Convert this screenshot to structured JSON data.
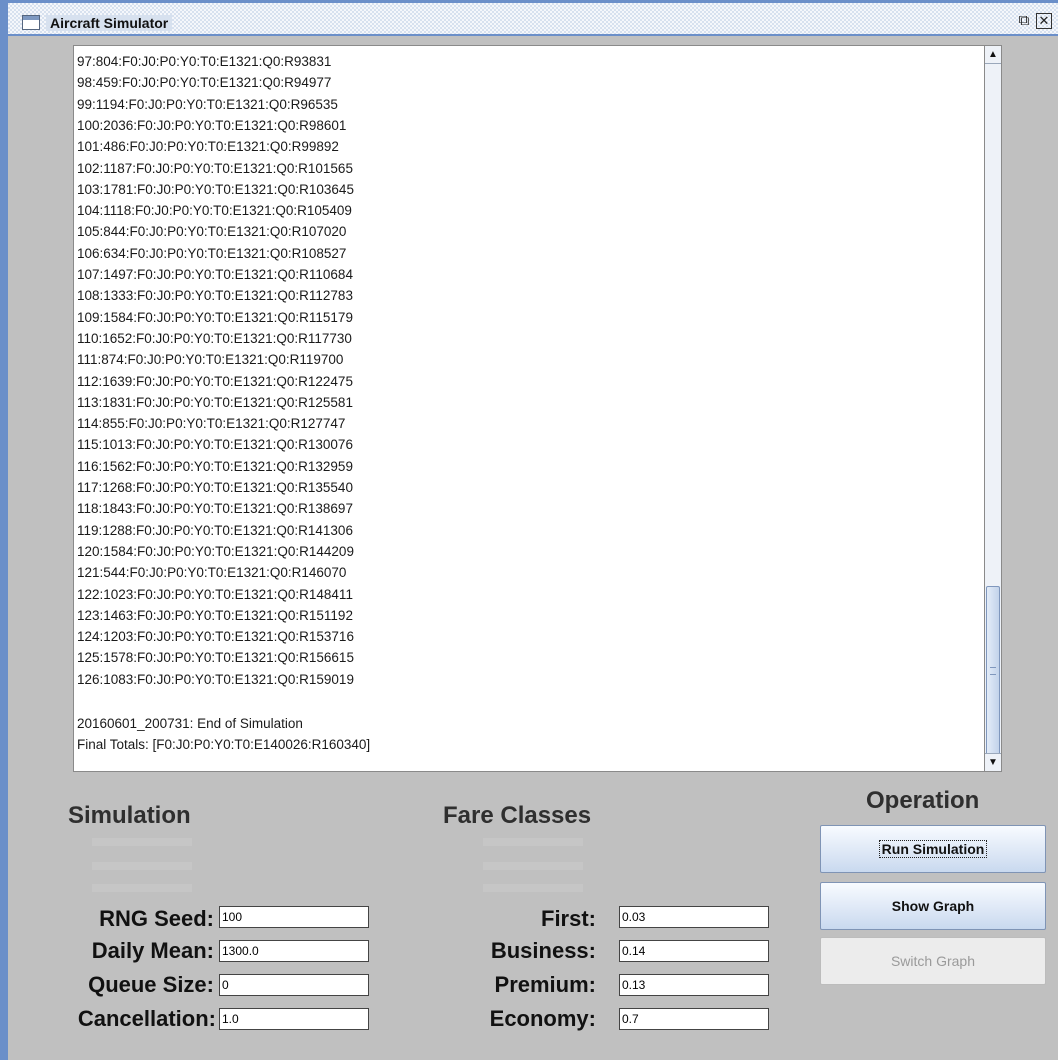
{
  "window": {
    "title": "Aircraft Simulator",
    "restore_glyph": "⧉",
    "close_glyph": "✕"
  },
  "log": {
    "lines": [
      "97:804:F0:J0:P0:Y0:T0:E1321:Q0:R93831",
      "98:459:F0:J0:P0:Y0:T0:E1321:Q0:R94977",
      "99:1194:F0:J0:P0:Y0:T0:E1321:Q0:R96535",
      "100:2036:F0:J0:P0:Y0:T0:E1321:Q0:R98601",
      "101:486:F0:J0:P0:Y0:T0:E1321:Q0:R99892",
      "102:1187:F0:J0:P0:Y0:T0:E1321:Q0:R101565",
      "103:1781:F0:J0:P0:Y0:T0:E1321:Q0:R103645",
      "104:1118:F0:J0:P0:Y0:T0:E1321:Q0:R105409",
      "105:844:F0:J0:P0:Y0:T0:E1321:Q0:R107020",
      "106:634:F0:J0:P0:Y0:T0:E1321:Q0:R108527",
      "107:1497:F0:J0:P0:Y0:T0:E1321:Q0:R110684",
      "108:1333:F0:J0:P0:Y0:T0:E1321:Q0:R112783",
      "109:1584:F0:J0:P0:Y0:T0:E1321:Q0:R115179",
      "110:1652:F0:J0:P0:Y0:T0:E1321:Q0:R117730",
      "111:874:F0:J0:P0:Y0:T0:E1321:Q0:R119700",
      "112:1639:F0:J0:P0:Y0:T0:E1321:Q0:R122475",
      "113:1831:F0:J0:P0:Y0:T0:E1321:Q0:R125581",
      "114:855:F0:J0:P0:Y0:T0:E1321:Q0:R127747",
      "115:1013:F0:J0:P0:Y0:T0:E1321:Q0:R130076",
      "116:1562:F0:J0:P0:Y0:T0:E1321:Q0:R132959",
      "117:1268:F0:J0:P0:Y0:T0:E1321:Q0:R135540",
      "118:1843:F0:J0:P0:Y0:T0:E1321:Q0:R138697",
      "119:1288:F0:J0:P0:Y0:T0:E1321:Q0:R141306",
      "120:1584:F0:J0:P0:Y0:T0:E1321:Q0:R144209",
      "121:544:F0:J0:P0:Y0:T0:E1321:Q0:R146070",
      "122:1023:F0:J0:P0:Y0:T0:E1321:Q0:R148411",
      "123:1463:F0:J0:P0:Y0:T0:E1321:Q0:R151192",
      "124:1203:F0:J0:P0:Y0:T0:E1321:Q0:R153716",
      "125:1578:F0:J0:P0:Y0:T0:E1321:Q0:R156615",
      "126:1083:F0:J0:P0:Y0:T0:E1321:Q0:R159019"
    ],
    "end_line": "20160601_200731: End of Simulation",
    "totals_line": "Final Totals: [F0:J0:P0:Y0:T0:E140026:R160340]"
  },
  "scrollbar": {
    "up_glyph": "▲",
    "down_glyph": "▼"
  },
  "simulation": {
    "title": "Simulation",
    "fields": [
      {
        "label": "RNG Seed:",
        "value": "100"
      },
      {
        "label": "Daily Mean:",
        "value": "1300.0"
      },
      {
        "label": "Queue Size:",
        "value": "0"
      },
      {
        "label": "Cancellation:",
        "value": "1.0"
      }
    ]
  },
  "fare_classes": {
    "title": "Fare Classes",
    "fields": [
      {
        "label": "First:",
        "value": "0.03"
      },
      {
        "label": "Business:",
        "value": "0.14"
      },
      {
        "label": "Premium:",
        "value": "0.13"
      },
      {
        "label": "Economy:",
        "value": "0.7"
      }
    ]
  },
  "operation": {
    "title": "Operation",
    "run_label": "Run Simulation",
    "show_graph_label": "Show Graph",
    "switch_graph_label": "Switch Graph"
  }
}
